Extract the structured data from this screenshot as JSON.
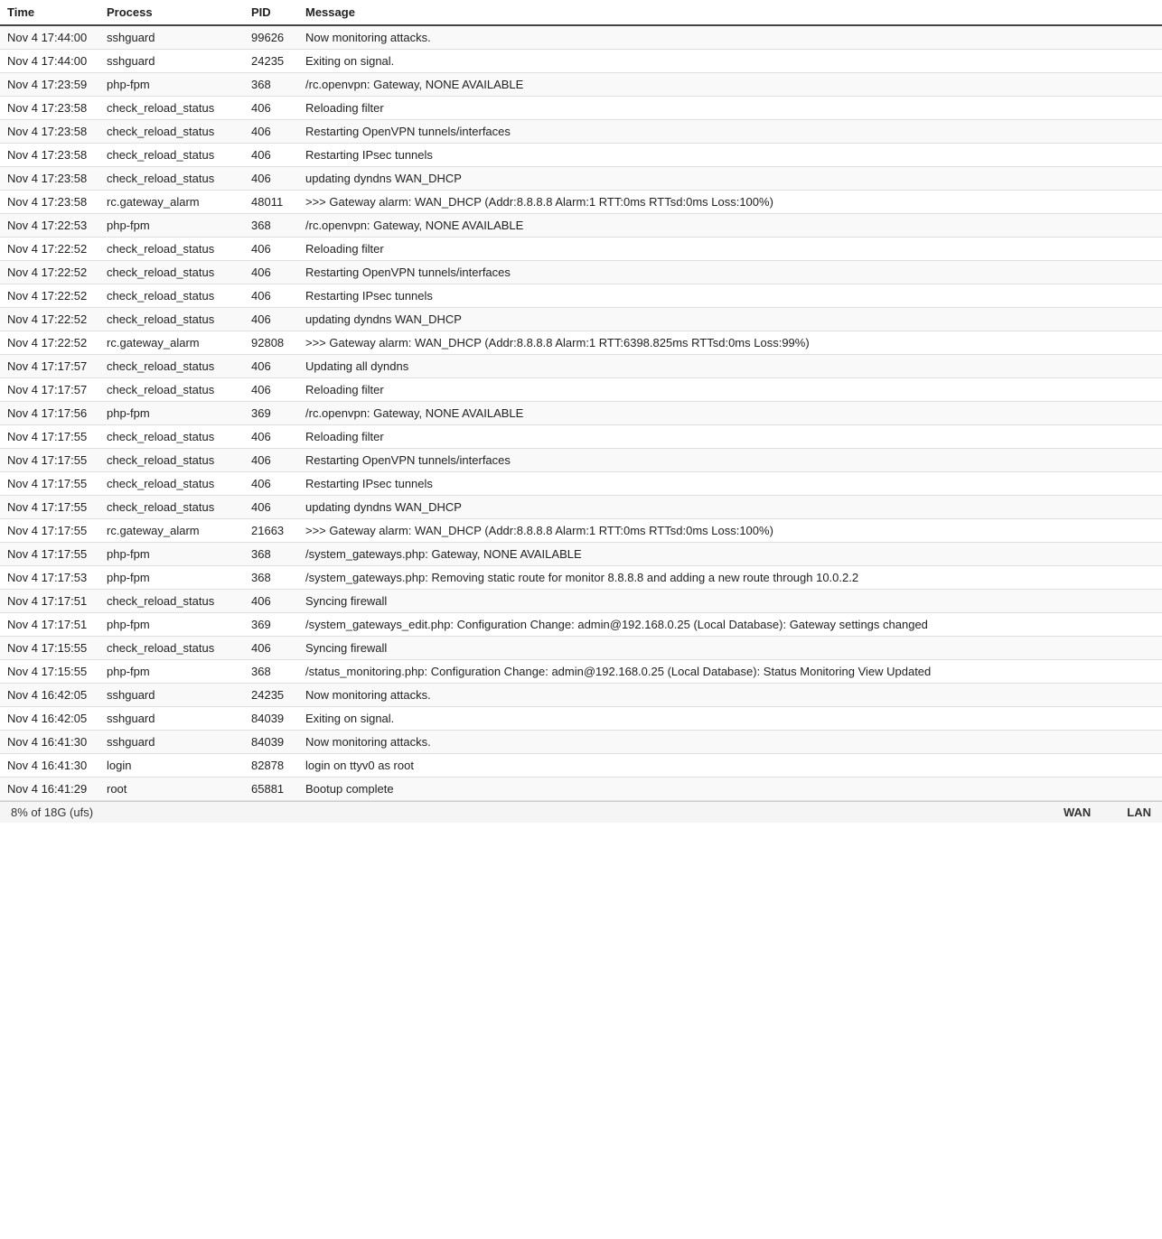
{
  "table": {
    "headers": {
      "time": "Time",
      "process": "Process",
      "pid": "PID",
      "message": "Message"
    },
    "rows": [
      {
        "time": "Nov 4 17:44:00",
        "process": "sshguard",
        "pid": "99626",
        "message": "Now monitoring attacks."
      },
      {
        "time": "Nov 4 17:44:00",
        "process": "sshguard",
        "pid": "24235",
        "message": "Exiting on signal."
      },
      {
        "time": "Nov 4 17:23:59",
        "process": "php-fpm",
        "pid": "368",
        "message": "/rc.openvpn: Gateway, NONE AVAILABLE"
      },
      {
        "time": "Nov 4 17:23:58",
        "process": "check_reload_status",
        "pid": "406",
        "message": "Reloading filter"
      },
      {
        "time": "Nov 4 17:23:58",
        "process": "check_reload_status",
        "pid": "406",
        "message": "Restarting OpenVPN tunnels/interfaces"
      },
      {
        "time": "Nov 4 17:23:58",
        "process": "check_reload_status",
        "pid": "406",
        "message": "Restarting IPsec tunnels"
      },
      {
        "time": "Nov 4 17:23:58",
        "process": "check_reload_status",
        "pid": "406",
        "message": "updating dyndns WAN_DHCP"
      },
      {
        "time": "Nov 4 17:23:58",
        "process": "rc.gateway_alarm",
        "pid": "48011",
        "message": ">>> Gateway alarm: WAN_DHCP (Addr:8.8.8.8 Alarm:1 RTT:0ms RTTsd:0ms Loss:100%)"
      },
      {
        "time": "Nov 4 17:22:53",
        "process": "php-fpm",
        "pid": "368",
        "message": "/rc.openvpn: Gateway, NONE AVAILABLE"
      },
      {
        "time": "Nov 4 17:22:52",
        "process": "check_reload_status",
        "pid": "406",
        "message": "Reloading filter"
      },
      {
        "time": "Nov 4 17:22:52",
        "process": "check_reload_status",
        "pid": "406",
        "message": "Restarting OpenVPN tunnels/interfaces"
      },
      {
        "time": "Nov 4 17:22:52",
        "process": "check_reload_status",
        "pid": "406",
        "message": "Restarting IPsec tunnels"
      },
      {
        "time": "Nov 4 17:22:52",
        "process": "check_reload_status",
        "pid": "406",
        "message": "updating dyndns WAN_DHCP"
      },
      {
        "time": "Nov 4 17:22:52",
        "process": "rc.gateway_alarm",
        "pid": "92808",
        "message": ">>> Gateway alarm: WAN_DHCP (Addr:8.8.8.8 Alarm:1 RTT:6398.825ms RTTsd:0ms Loss:99%)"
      },
      {
        "time": "Nov 4 17:17:57",
        "process": "check_reload_status",
        "pid": "406",
        "message": "Updating all dyndns"
      },
      {
        "time": "Nov 4 17:17:57",
        "process": "check_reload_status",
        "pid": "406",
        "message": "Reloading filter"
      },
      {
        "time": "Nov 4 17:17:56",
        "process": "php-fpm",
        "pid": "369",
        "message": "/rc.openvpn: Gateway, NONE AVAILABLE"
      },
      {
        "time": "Nov 4 17:17:55",
        "process": "check_reload_status",
        "pid": "406",
        "message": "Reloading filter"
      },
      {
        "time": "Nov 4 17:17:55",
        "process": "check_reload_status",
        "pid": "406",
        "message": "Restarting OpenVPN tunnels/interfaces"
      },
      {
        "time": "Nov 4 17:17:55",
        "process": "check_reload_status",
        "pid": "406",
        "message": "Restarting IPsec tunnels"
      },
      {
        "time": "Nov 4 17:17:55",
        "process": "check_reload_status",
        "pid": "406",
        "message": "updating dyndns WAN_DHCP"
      },
      {
        "time": "Nov 4 17:17:55",
        "process": "rc.gateway_alarm",
        "pid": "21663",
        "message": ">>> Gateway alarm: WAN_DHCP (Addr:8.8.8.8 Alarm:1 RTT:0ms RTTsd:0ms Loss:100%)"
      },
      {
        "time": "Nov 4 17:17:55",
        "process": "php-fpm",
        "pid": "368",
        "message": "/system_gateways.php: Gateway, NONE AVAILABLE"
      },
      {
        "time": "Nov 4 17:17:53",
        "process": "php-fpm",
        "pid": "368",
        "message": "/system_gateways.php: Removing static route for monitor 8.8.8.8 and adding a new route through 10.0.2.2"
      },
      {
        "time": "Nov 4 17:17:51",
        "process": "check_reload_status",
        "pid": "406",
        "message": "Syncing firewall"
      },
      {
        "time": "Nov 4 17:17:51",
        "process": "php-fpm",
        "pid": "369",
        "message": "/system_gateways_edit.php: Configuration Change: admin@192.168.0.25 (Local Database): Gateway settings changed"
      },
      {
        "time": "Nov 4 17:15:55",
        "process": "check_reload_status",
        "pid": "406",
        "message": "Syncing firewall"
      },
      {
        "time": "Nov 4 17:15:55",
        "process": "php-fpm",
        "pid": "368",
        "message": "/status_monitoring.php: Configuration Change: admin@192.168.0.25 (Local Database): Status Monitoring View Updated"
      },
      {
        "time": "Nov 4 16:42:05",
        "process": "sshguard",
        "pid": "24235",
        "message": "Now monitoring attacks."
      },
      {
        "time": "Nov 4 16:42:05",
        "process": "sshguard",
        "pid": "84039",
        "message": "Exiting on signal."
      },
      {
        "time": "Nov 4 16:41:30",
        "process": "sshguard",
        "pid": "84039",
        "message": "Now monitoring attacks."
      },
      {
        "time": "Nov 4 16:41:30",
        "process": "login",
        "pid": "82878",
        "message": "login on ttyv0 as root"
      },
      {
        "time": "Nov 4 16:41:29",
        "process": "root",
        "pid": "65881",
        "message": "Bootup complete"
      }
    ]
  },
  "bottom_bar": {
    "disk_info": "8% of 18G (ufs)",
    "nav_items": [
      "WAN",
      "LAN"
    ]
  }
}
